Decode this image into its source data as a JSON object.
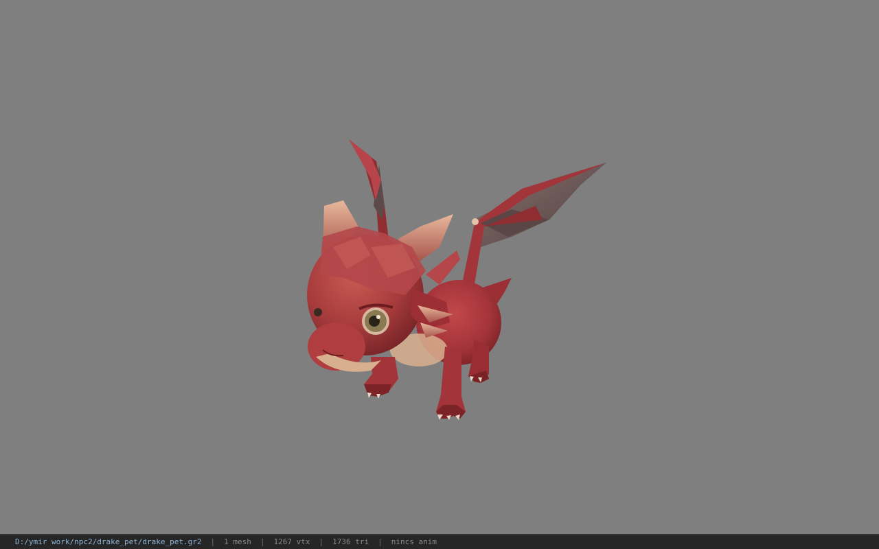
{
  "viewer": {
    "background_color": "#7f7f7f",
    "model_name": "drake_pet",
    "model_colors": {
      "body": "#a8363a",
      "body_shade": "#7d2226",
      "belly": "#d9b08f",
      "horn": "#c88a72",
      "wing_membrane": "#6e5a58",
      "eye": "#8a7a52"
    }
  },
  "status_bar": {
    "file_path": "D:/ymir work/npc2/drake_pet/drake_pet.gr2",
    "mesh_count": "1 mesh",
    "vertex_count": "1267 vtx",
    "triangle_count": "1736 tri",
    "anim_info": "nincs anim",
    "separator": "|",
    "background_color": "#262626",
    "path_color": "#8fb4d8",
    "text_color": "#8a8a8a"
  }
}
